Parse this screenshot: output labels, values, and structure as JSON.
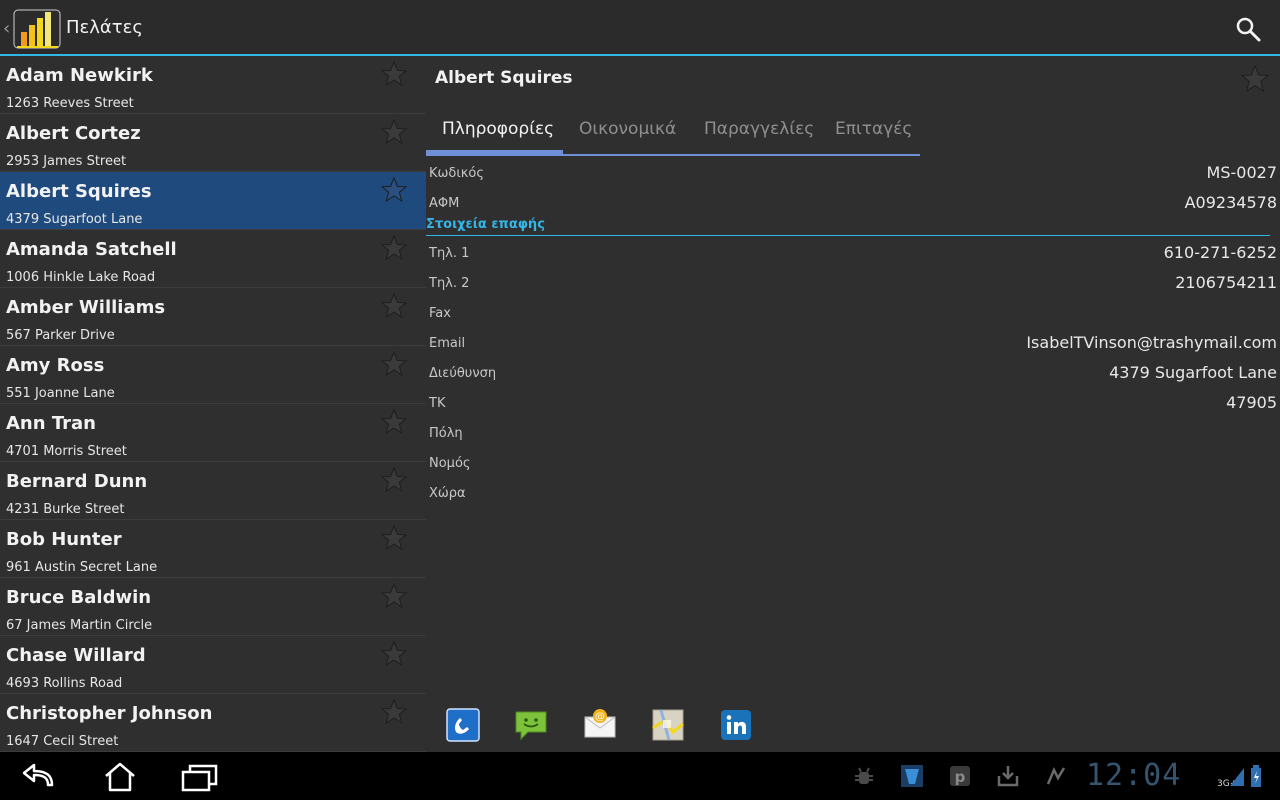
{
  "actionbar": {
    "title": "Πελάτες",
    "back_icon": "‹"
  },
  "contacts": [
    {
      "name": "Adam Newkirk",
      "address": "1263 Reeves Street"
    },
    {
      "name": "Albert Cortez",
      "address": "2953 James Street"
    },
    {
      "name": "Albert Squires",
      "address": "4379 Sugarfoot Lane",
      "selected": true
    },
    {
      "name": "Amanda Satchell",
      "address": "1006 Hinkle Lake Road"
    },
    {
      "name": "Amber Williams",
      "address": "567 Parker Drive"
    },
    {
      "name": "Amy Ross",
      "address": "551 Joanne Lane"
    },
    {
      "name": "Ann Tran",
      "address": "4701 Morris Street"
    },
    {
      "name": "Bernard Dunn",
      "address": "4231 Burke Street"
    },
    {
      "name": "Bob Hunter",
      "address": "961 Austin Secret Lane"
    },
    {
      "name": "Bruce Baldwin",
      "address": "67 James Martin Circle"
    },
    {
      "name": "Chase Willard",
      "address": "4693 Rollins Road"
    },
    {
      "name": "Christopher Johnson",
      "address": "1647 Cecil Street"
    }
  ],
  "detail": {
    "name": "Albert Squires",
    "tabs": [
      "Πληροφορίες",
      "Οικονομικά",
      "Παραγγελίες",
      "Επιταγές"
    ],
    "active_tab": 0,
    "fields_top": [
      {
        "label": "Κωδικός",
        "value": "MS-0027"
      },
      {
        "label": "ΑΦΜ",
        "value": "A09234578"
      }
    ],
    "section_title": "Στοιχεία επαφής",
    "fields_contact": [
      {
        "label": "Τηλ. 1",
        "value": "610-271-6252"
      },
      {
        "label": "Τηλ. 2",
        "value": "2106754211"
      },
      {
        "label": "Fax",
        "value": ""
      },
      {
        "label": "Email",
        "value": "IsabelTVinson@trashymail.com"
      },
      {
        "label": "Διεύθυνση",
        "value": "4379 Sugarfoot Lane"
      },
      {
        "label": "ΤΚ",
        "value": "47905"
      },
      {
        "label": "Πόλη",
        "value": ""
      },
      {
        "label": "Νομός",
        "value": ""
      },
      {
        "label": "Χώρα",
        "value": ""
      }
    ],
    "quick_actions": [
      "phone-icon",
      "sms-icon",
      "email-icon",
      "maps-icon",
      "linkedin-icon"
    ]
  },
  "statusbar": {
    "time": "12:04",
    "network": "3G+"
  },
  "colors": {
    "accent": "#33b5e5",
    "selected_row": "#1f4a7d",
    "tab_indicator": "#6f8fd6"
  }
}
